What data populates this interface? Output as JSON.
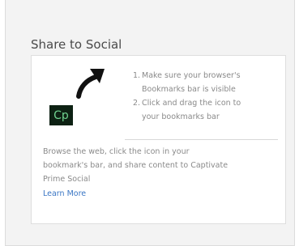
{
  "widget": {
    "title": "Share to Social",
    "logo_text": "Cp",
    "steps": [
      {
        "num": "1.",
        "lines": [
          "Make sure your browser's",
          "Bookmarks bar is visible"
        ]
      },
      {
        "num": "2.",
        "lines": [
          "Click and drag the icon to",
          "your bookmarks bar"
        ]
      }
    ],
    "description_lines": [
      "Browse the web, click the icon in your",
      "bookmark's bar, and share content to Captivate",
      "Prime Social"
    ],
    "learn_more": "Learn More"
  },
  "colors": {
    "panel_bg": "#f3f3f3",
    "card_bg": "#ffffff",
    "logo_bg": "#0d2113",
    "logo_text": "#6fd28f",
    "link": "#3a76c4",
    "muted_text": "#8a8a8a"
  },
  "icons": {
    "arrow": "curved-arrow-icon"
  }
}
